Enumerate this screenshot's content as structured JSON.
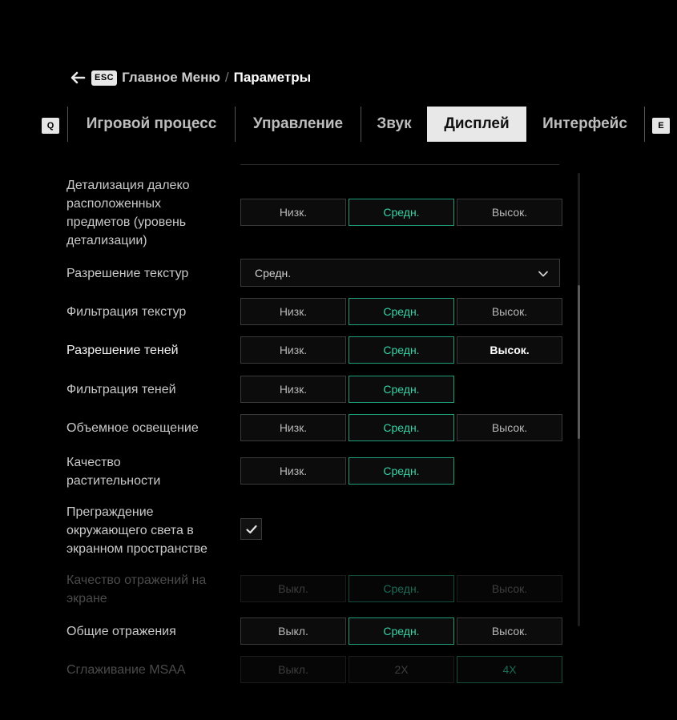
{
  "breadcrumb": {
    "esc": "ESC",
    "main": "Главное Меню",
    "sep": "/",
    "current": "Параметры"
  },
  "tabs": {
    "left_key": "Q",
    "right_key": "E",
    "items": [
      {
        "label": "Игровой процесс"
      },
      {
        "label": "Управление"
      },
      {
        "label": "Звук"
      },
      {
        "label": "Дисплей",
        "active": true
      },
      {
        "label": "Интерфейс"
      }
    ]
  },
  "settings": [
    {
      "label": "Детализация далеко расположенных предметов (уровень детализации)",
      "type": "segmented",
      "options": [
        "Низк.",
        "Средн.",
        "Высок."
      ],
      "selected": "Средн."
    },
    {
      "label": "Разрешение текстур",
      "type": "dropdown",
      "value": "Средн."
    },
    {
      "label": "Фильтрация текстур",
      "type": "segmented",
      "options": [
        "Низк.",
        "Средн.",
        "Высок."
      ],
      "selected": "Средн."
    },
    {
      "label": "Разрешение теней",
      "type": "segmented",
      "options": [
        "Низк.",
        "Средн.",
        "Высок."
      ],
      "selected": "Средн.",
      "hovered": true
    },
    {
      "label": "Фильтрация теней",
      "type": "segmented",
      "options": [
        "Низк.",
        "Средн."
      ],
      "selected": "Средн."
    },
    {
      "label": "Объемное освещение",
      "type": "segmented",
      "options": [
        "Низк.",
        "Средн.",
        "Высок."
      ],
      "selected": "Средн."
    },
    {
      "label": "Качество растительности",
      "type": "segmented",
      "options": [
        "Низк.",
        "Средн."
      ],
      "selected": "Средн."
    },
    {
      "label": "Преграждение окружающего света в экранном пространстве",
      "type": "checkbox",
      "checked": true
    },
    {
      "label": "Качество отражений на экране",
      "type": "segmented",
      "options": [
        "Выкл.",
        "Средн.",
        "Высок."
      ],
      "selected": "Средн.",
      "disabled": true
    },
    {
      "label": "Общие отражения",
      "type": "segmented",
      "options": [
        "Выкл.",
        "Средн.",
        "Высок."
      ],
      "selected": "Средн."
    },
    {
      "label": "Сглаживание MSAA",
      "type": "segmented",
      "options": [
        "Выкл.",
        "2X",
        "4X"
      ],
      "selected": "4X",
      "disabled": true
    }
  ],
  "colors": {
    "accent": "#1f9e7a",
    "accent_text": "#35d3a6",
    "background": "#000000"
  }
}
